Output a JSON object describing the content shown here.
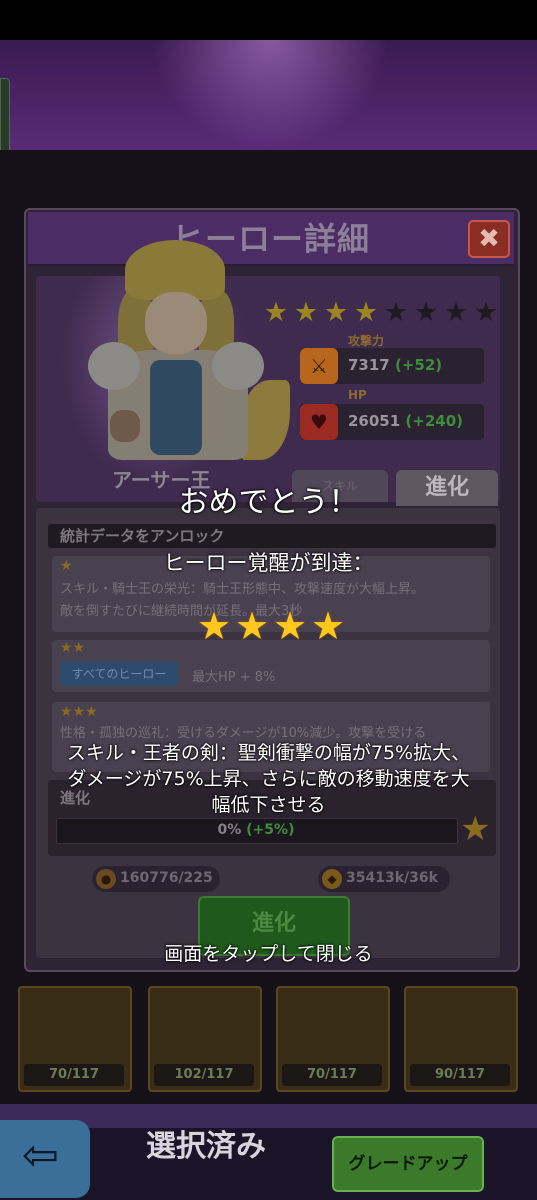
{
  "dialog": {
    "title": "ヒーロー詳細",
    "close_symbol": "✖",
    "hero_name": "アーサー王",
    "stars": {
      "lit": 4,
      "total": 8,
      "symbol": "★"
    },
    "stats": [
      {
        "label": "攻撃力",
        "value": "7317",
        "bonus": "(+52)",
        "icon": "sword-icon"
      },
      {
        "label": "HP",
        "value": "26051",
        "bonus": "(+240)",
        "icon": "heart-icon"
      }
    ],
    "tabs": {
      "left": "スキル",
      "evolve": "進化"
    },
    "unlock_title": "統計データをアンロック",
    "cards": [
      {
        "stars": "★",
        "text_line1": "スキル・騎士王の栄光：騎士王形態中、攻撃速度が大幅上昇。",
        "text_line2": "敵を倒すたびに継続時間が延長。最大3秒"
      },
      {
        "stars": "★★",
        "badge": "すべてのヒーロー",
        "text_line1": "最大HP + 8%"
      },
      {
        "stars": "★★★",
        "text_line1": "性格・孤独の巡礼：受けるダメージが10%減少。攻撃を受ける"
      }
    ],
    "evolve_label": "進化",
    "progress_text": "0%",
    "progress_bonus": "(+5%)",
    "resources": [
      {
        "text": "160776/225",
        "icon": "coin-icon"
      },
      {
        "text": "35413k/36k",
        "icon": "gem-icon"
      }
    ],
    "evolve_button": "進化"
  },
  "hero_cards": [
    "70/117",
    "102/117",
    "70/117",
    "90/117"
  ],
  "bottom_bar": {
    "back_symbol": "⇦",
    "selected_label": "選択済み",
    "grade_up_button": "グレードアップ"
  },
  "overlay": {
    "congrats": "おめでとう！",
    "awaken_text": "ヒーロー覚醒が到達：",
    "awaken_stars": 4,
    "star_symbol": "★",
    "skill_line1": "スキル・王者の剣：聖剣衝撃の幅が75%拡大、",
    "skill_line2": "ダメージが75%上昇、さらに敵の移動速度を大",
    "skill_line3": "幅低下させる",
    "tap_close": "画面をタップして閉じる"
  },
  "colors": {
    "star_gold": "#ffc81e",
    "header_purple": "#4b2c64",
    "green_button": "#3a7a2a"
  }
}
